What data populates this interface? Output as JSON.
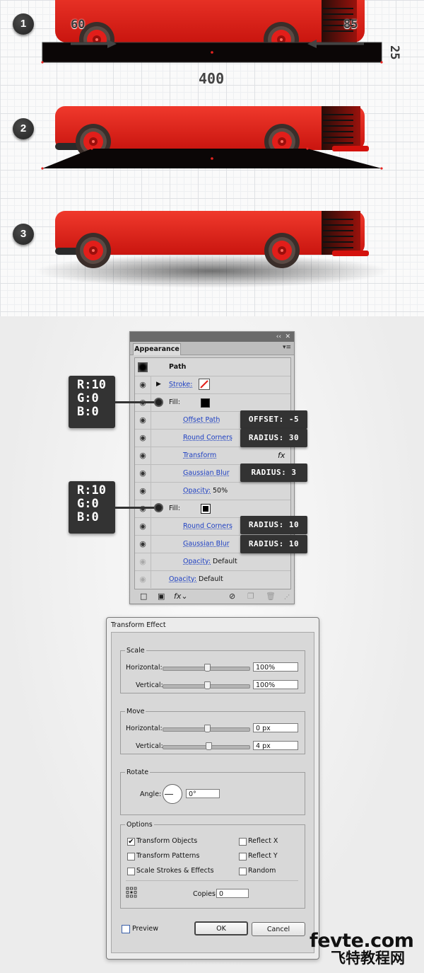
{
  "steps": [
    "1",
    "2",
    "3"
  ],
  "step1": {
    "left_dim": "60",
    "right_dim": "85",
    "height_dim": "25",
    "width_dim": "400"
  },
  "colors": {
    "bus_red": "#e8231f",
    "shape_dark": "#0b0606",
    "anchor": "#e8231f"
  },
  "fill_callouts": [
    {
      "r": "R:10",
      "g": "G:0",
      "b": "B:0"
    },
    {
      "r": "R:10",
      "g": "G:0",
      "b": "B:0"
    }
  ],
  "appearance_panel": {
    "collapse": "‹‹",
    "close": "✕",
    "tab": "Appearance",
    "menu": "▾≡",
    "rows": {
      "path": "Path",
      "stroke": "Stroke:",
      "fill1": "Fill:",
      "offset_path": "Offset Path",
      "round_corners1": "Round Corners",
      "transform": "Transform",
      "fx": "fx",
      "gaussian_blur1": "Gaussian Blur",
      "opacity1_label": "Opacity:",
      "opacity1_value": "50%",
      "fill2": "Fill:",
      "round_corners2": "Round Corners",
      "gaussian_blur2": "Gaussian Blur",
      "opacity2_label": "Opacity:",
      "opacity2_value": "Default",
      "opacity3_label": "Opacity:",
      "opacity3_value": "Default"
    },
    "callouts": {
      "offset": "OFFSET: -5",
      "radius30": "RADIUS: 30",
      "radius3": "RADIUS: 3",
      "radius10a": "RADIUS: 10",
      "radius10b": "RADIUS: 10"
    },
    "footer": {
      "fx": "fx⌄"
    }
  },
  "transform_dialog": {
    "title": "Transform Effect",
    "scale": {
      "legend": "Scale",
      "horizontal_label": "Horizontal:",
      "horizontal_value": "100%",
      "vertical_label": "Vertical:",
      "vertical_value": "100%"
    },
    "move": {
      "legend": "Move",
      "horizontal_label": "Horizontal:",
      "horizontal_value": "0 px",
      "vertical_label": "Vertical:",
      "vertical_value": "4 px"
    },
    "rotate": {
      "legend": "Rotate",
      "angle_label": "Angle:",
      "angle_value": "0°"
    },
    "options": {
      "legend": "Options",
      "transform_objects": "Transform Objects",
      "transform_objects_checked": true,
      "transform_patterns": "Transform Patterns",
      "scale_strokes": "Scale Strokes & Effects",
      "reflect_x": "Reflect X",
      "reflect_y": "Reflect Y",
      "random": "Random",
      "copies_label": "Copies",
      "copies_value": "0"
    },
    "preview": "Preview",
    "ok": "OK",
    "cancel": "Cancel"
  },
  "watermark": {
    "line1": "fevte.com",
    "line2": "飞特教程网"
  }
}
